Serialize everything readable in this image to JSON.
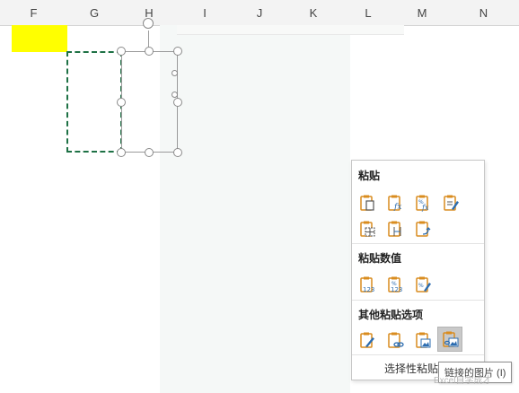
{
  "columns": [
    "F",
    "G",
    "H",
    "I",
    "J",
    "K",
    "L",
    "M",
    "N"
  ],
  "colors": {
    "highlight_cell": "#ffff00",
    "copy_marquee": "#1e7145",
    "clipboard_icon": "#d98c1f",
    "icon_blue": "#2b6cb0"
  },
  "paste_menu": {
    "paste_header": "粘贴",
    "paste_values_header": "粘贴数值",
    "other_paste_header": "其他粘贴选项",
    "paste_special": "选择性粘贴",
    "icons": {
      "paste": [
        "paste-icon",
        "paste-formulas-icon",
        "paste-formulas-number-format-icon",
        "keep-source-formatting-icon",
        "no-borders-icon",
        "keep-column-widths-icon",
        "transpose-icon"
      ],
      "values": [
        "values-icon",
        "values-number-format-icon",
        "values-source-formatting-icon"
      ],
      "other": [
        "formatting-icon",
        "paste-link-icon",
        "picture-icon",
        "linked-picture-icon"
      ]
    }
  },
  "tooltip": "链接的图片 (I)",
  "watermark": "Excel自学成才"
}
